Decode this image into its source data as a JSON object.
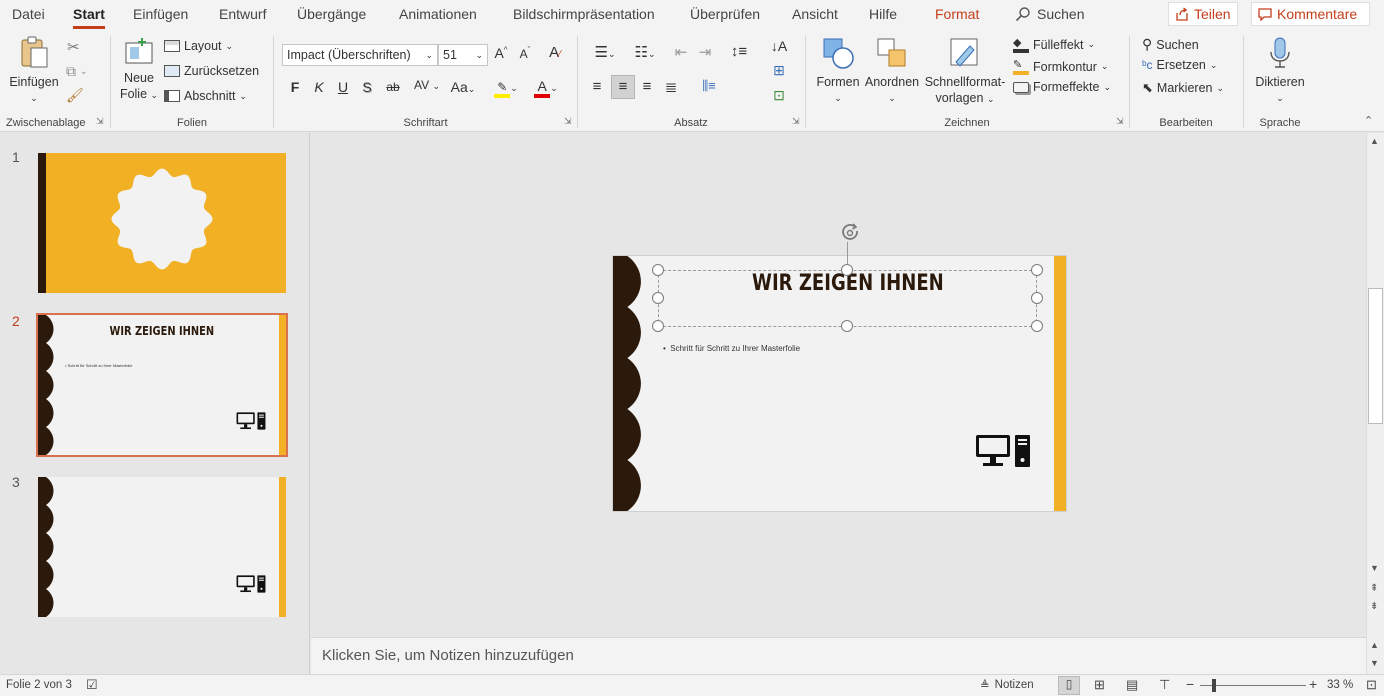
{
  "menu": {
    "file": "Datei",
    "start": "Start",
    "insert": "Einfügen",
    "design": "Entwurf",
    "transitions": "Übergänge",
    "animations": "Animationen",
    "slideshow": "Bildschirmpräsentation",
    "review": "Überprüfen",
    "view": "Ansicht",
    "help": "Hilfe",
    "format": "Format",
    "search": "Suchen"
  },
  "top_buttons": {
    "share": "Teilen",
    "comments": "Kommentare"
  },
  "ribbon": {
    "clipboard": {
      "label": "Zwischenablage",
      "paste": "Einfügen"
    },
    "slides": {
      "label": "Folien",
      "new_slide_line1": "Neue",
      "new_slide_line2": "Folie",
      "layout": "Layout",
      "reset": "Zurücksetzen",
      "section": "Abschnitt"
    },
    "font": {
      "label": "Schriftart",
      "font_name": "Impact (Überschriften)",
      "font_size": "51",
      "bold": "F",
      "italic": "K",
      "underline": "U",
      "shadow": "S",
      "strike": "ab",
      "spacing": "AV",
      "case": "Aa",
      "grow": "A",
      "shrink": "A",
      "color": "A"
    },
    "paragraph": {
      "label": "Absatz"
    },
    "drawing": {
      "label": "Zeichnen",
      "shapes": "Formen",
      "arrange": "Anordnen",
      "quickstyles_line1": "Schnellformat-",
      "quickstyles_line2": "vorlagen",
      "fill": "Fülleffekt",
      "outline": "Formkontur",
      "effects": "Formeffekte"
    },
    "editing": {
      "label": "Bearbeiten",
      "find": "Suchen",
      "replace": "Ersetzen",
      "select": "Markieren"
    },
    "voice": {
      "label": "Sprache",
      "dictate": "Diktieren"
    }
  },
  "slides": [
    {
      "number": "1",
      "selected": false,
      "title": "",
      "bullet": ""
    },
    {
      "number": "2",
      "selected": true,
      "title": "WIR ZEIGEN IHNEN",
      "bullet": "Schritt für Schritt zu Ihrer Masterfolie"
    },
    {
      "number": "3",
      "selected": false,
      "title": "",
      "bullet": ""
    }
  ],
  "current_slide": {
    "title": "WIR ZEIGEN IHNEN",
    "bullet": "Schritt für Schritt zu Ihrer Masterfolie"
  },
  "notes_placeholder": "Klicken Sie, um Notizen hinzuzufügen",
  "status": {
    "slide_info": "Folie 2 von 3",
    "notes": "Notizen",
    "zoom": "33 %",
    "zoom_level": 0.33
  },
  "colors": {
    "accent": "#c43e1c",
    "slide_yellow": "#f2b124",
    "slide_brown": "#2b1a0b",
    "slide_bg": "#f2f2f2"
  }
}
